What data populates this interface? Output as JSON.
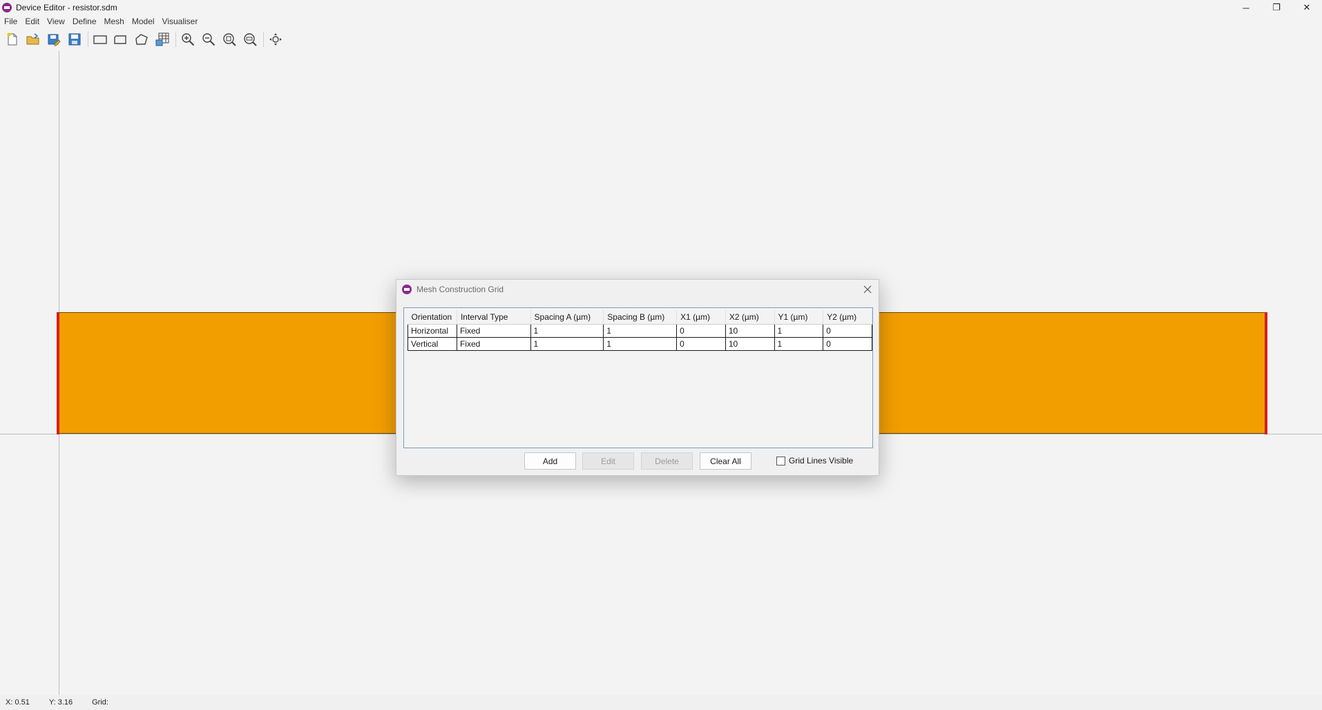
{
  "window": {
    "title": "Device Editor - resistor.sdm",
    "minimize": "─",
    "restore": "❐",
    "close": "✕"
  },
  "menu": [
    "File",
    "Edit",
    "View",
    "Define",
    "Mesh",
    "Model",
    "Visualiser"
  ],
  "toolbar": {
    "icons": [
      "new-file-icon",
      "open-folder-icon",
      "save-as-icon",
      "save-icon",
      "rectangle-icon",
      "rounded-rectangle-icon",
      "polygon-icon",
      "mesh-grid-icon",
      "zoom-in-icon",
      "zoom-out-icon",
      "zoom-fit-icon",
      "zoom-extents-icon",
      "pan-icon"
    ]
  },
  "colors": {
    "resistor": "#f29e00",
    "contact": "#d81e1e",
    "app_icon": "#8a2a8a"
  },
  "status": {
    "x": "X: 0.51",
    "y": "Y: 3.16",
    "grid": "Grid:"
  },
  "dialog": {
    "title": "Mesh Construction Grid",
    "columns": [
      "Orientation",
      "Interval Type",
      "Spacing A (µm)",
      "Spacing B (µm)",
      "X1 (µm)",
      "X2 (µm)",
      "Y1 (µm)",
      "Y2 (µm)"
    ],
    "rows": [
      [
        "Horizontal",
        "Fixed",
        "1",
        "1",
        "0",
        "10",
        "1",
        "0"
      ],
      [
        "Vertical",
        "Fixed",
        "1",
        "1",
        "0",
        "10",
        "1",
        "0"
      ]
    ],
    "buttons": {
      "add": "Add",
      "edit": "Edit",
      "delete": "Delete",
      "clear_all": "Clear All"
    },
    "grid_lines_visible_label": "Grid Lines Visible",
    "grid_lines_visible_checked": false
  }
}
